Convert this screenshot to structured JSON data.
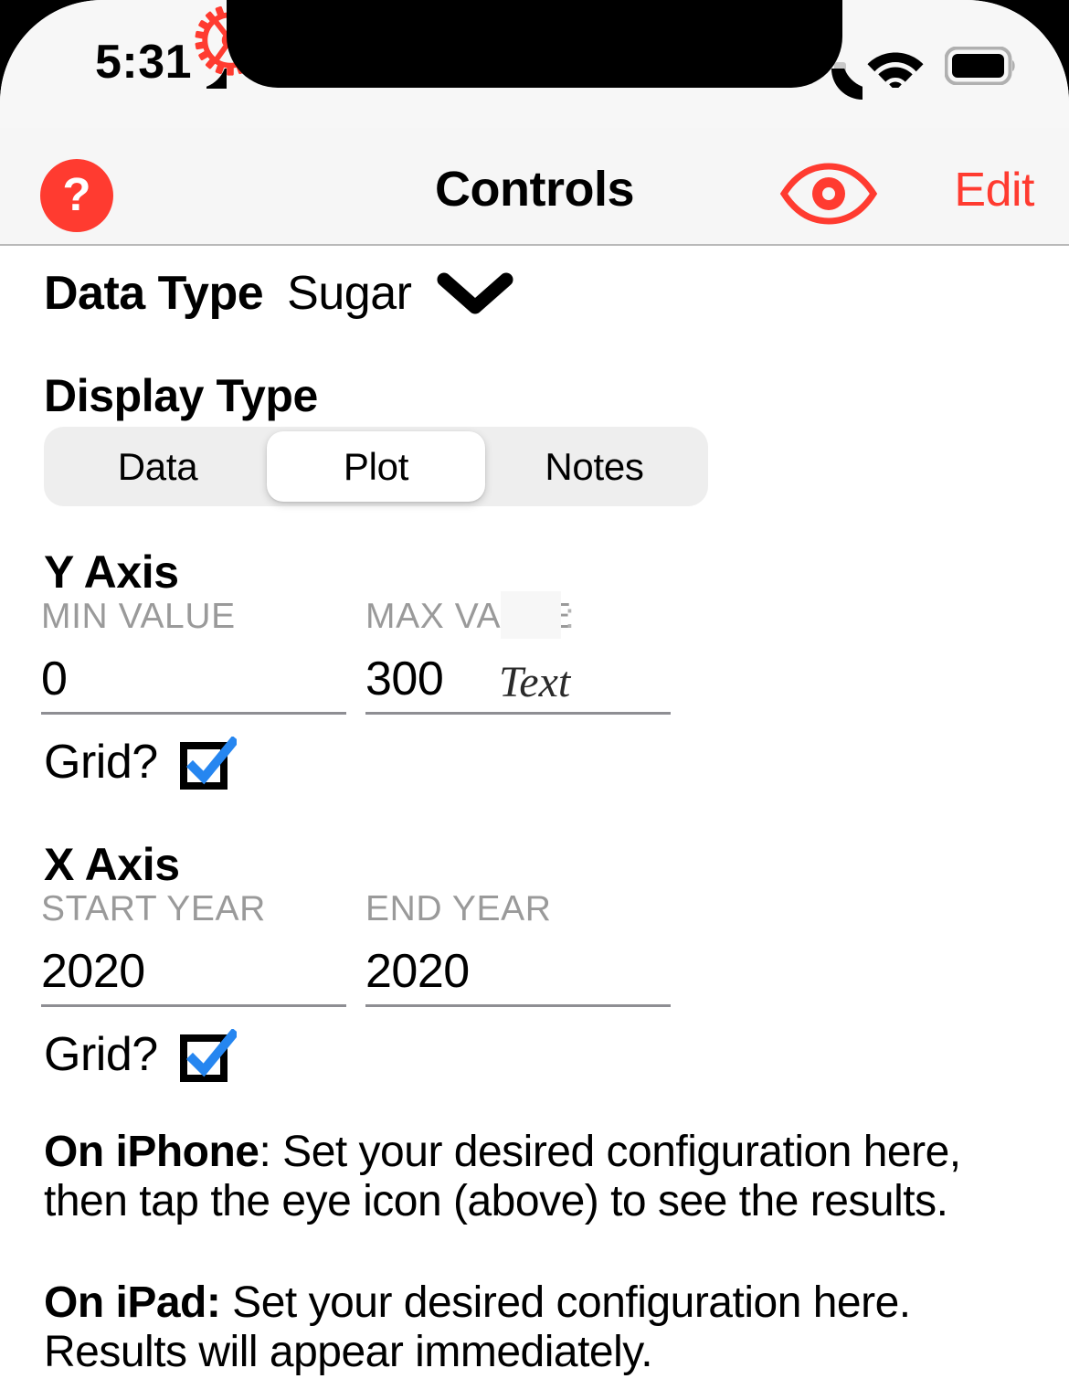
{
  "statusbar": {
    "time": "5:31",
    "signal_icon": "signal-dots-icon",
    "wifi_icon": "wifi-icon",
    "battery_icon": "battery-icon"
  },
  "navbar": {
    "help_icon": "help-question-icon",
    "help_label": "?",
    "gear_icon": "gear-icon",
    "title": "Controls",
    "eye_icon": "eye-icon",
    "edit_label": "Edit"
  },
  "data_type": {
    "label": "Data Type",
    "value": "Sugar",
    "chevron_icon": "chevron-down-icon"
  },
  "display_type": {
    "heading": "Display Type",
    "options": [
      {
        "label": "Data",
        "selected": false
      },
      {
        "label": "Plot",
        "selected": true
      },
      {
        "label": "Notes",
        "selected": false
      }
    ],
    "selected": "Plot"
  },
  "y_axis": {
    "heading": "Y Axis",
    "min": {
      "caption": "MIN VALUE",
      "value": "0"
    },
    "max": {
      "caption": "MAX VA",
      "caption_full": "MAX VALUE",
      "value": "300",
      "suffix_mark": ":",
      "ghost_text": "Text"
    },
    "grid": {
      "label": "Grid?",
      "checked": true
    }
  },
  "x_axis": {
    "heading": "X Axis",
    "start": {
      "caption": "START YEAR",
      "value": "2020"
    },
    "end": {
      "caption": "END YEAR",
      "value": "2020"
    },
    "grid": {
      "label": "Grid?",
      "checked": true
    }
  },
  "notes": [
    {
      "bold": "On iPhone",
      "rest": ": Set your desired configuration here, then tap the eye icon (above) to see the results."
    },
    {
      "bold": "On iPad:",
      "rest": " Set your desired configuration here. Results will appear immediately."
    }
  ],
  "colors": {
    "accent_red": "#ff3b30",
    "check_blue": "#2686f0",
    "caption_gray": "#9a9a9a",
    "navbar_bg": "#f6f6f6",
    "segment_bg": "#eeeeee"
  }
}
